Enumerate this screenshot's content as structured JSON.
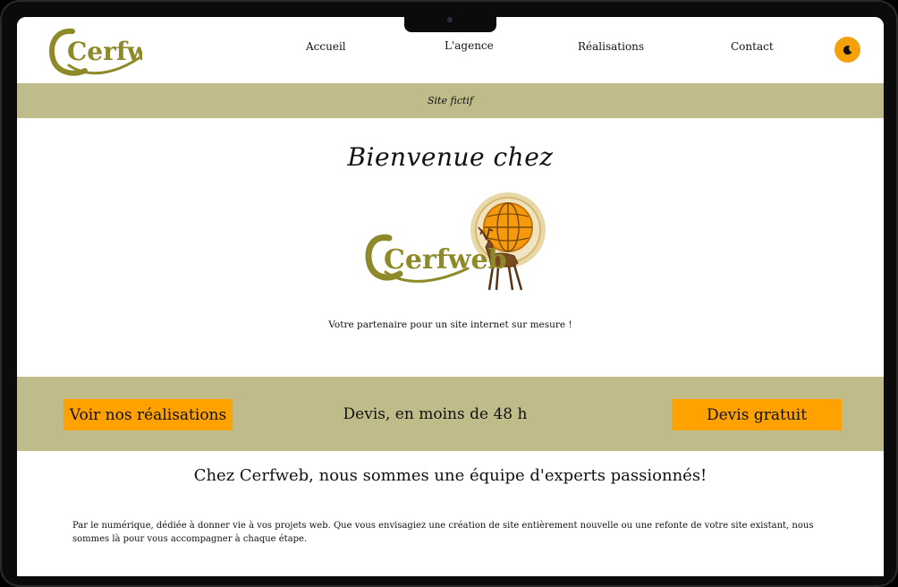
{
  "nav": {
    "logo_text": "Cerfweb",
    "links": [
      "Accueil",
      "L'agence",
      "Réalisations",
      "Contact"
    ],
    "theme_icon": "moon-icon"
  },
  "banner": {
    "text": "Site fictif"
  },
  "hero": {
    "welcome": "Bienvenue chez",
    "logo_text": "Cerfweb",
    "tagline": "Votre partenaire pour un site internet sur mesure !"
  },
  "cta": {
    "left_button": "Voir nos réalisations",
    "middle_text": "Devis, en moins de 48 h",
    "right_button": "Devis gratuit"
  },
  "about": {
    "title": "Chez Cerfweb, nous sommes une équipe d'experts passionnés!",
    "text": "Par le numérique, dédiée à donner vie à vos projets web. Que vous envisagiez une création de site entièrement nouvelle ou une refonte de votre site existant, nous sommes là pour vous accompagner à chaque étape."
  },
  "colors": {
    "olive": "#8e8a2a",
    "khaki": "#bfbc89",
    "orange": "#ffa200"
  }
}
